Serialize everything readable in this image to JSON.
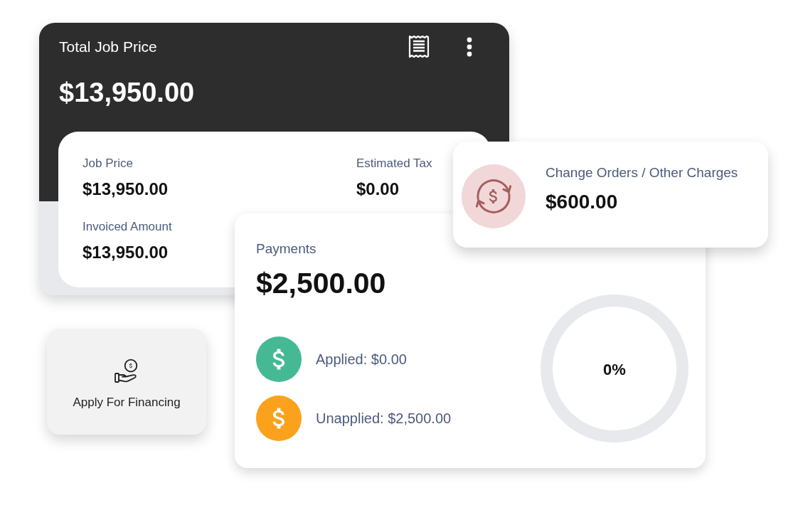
{
  "job_price_card": {
    "title": "Total Job Price",
    "total": "$13,950.00",
    "details": [
      {
        "label": "Job Price",
        "value": "$13,950.00"
      },
      {
        "label": "Estimated Tax",
        "value": "$0.00"
      },
      {
        "label": "Invoiced Amount",
        "value": "$13,950.00"
      }
    ]
  },
  "financing_button": {
    "label": "Apply For Financing"
  },
  "payments_card": {
    "title": "Payments",
    "total": "$2,500.00",
    "items": [
      {
        "label": "Applied: $0.00",
        "color": "#45b994"
      },
      {
        "label": "Unapplied: $2,500.00",
        "color": "#fba21c"
      }
    ],
    "progress": {
      "reading": "0%"
    }
  },
  "change_orders_card": {
    "label": "Change Orders / Other Charges",
    "value": "$600.00"
  }
}
